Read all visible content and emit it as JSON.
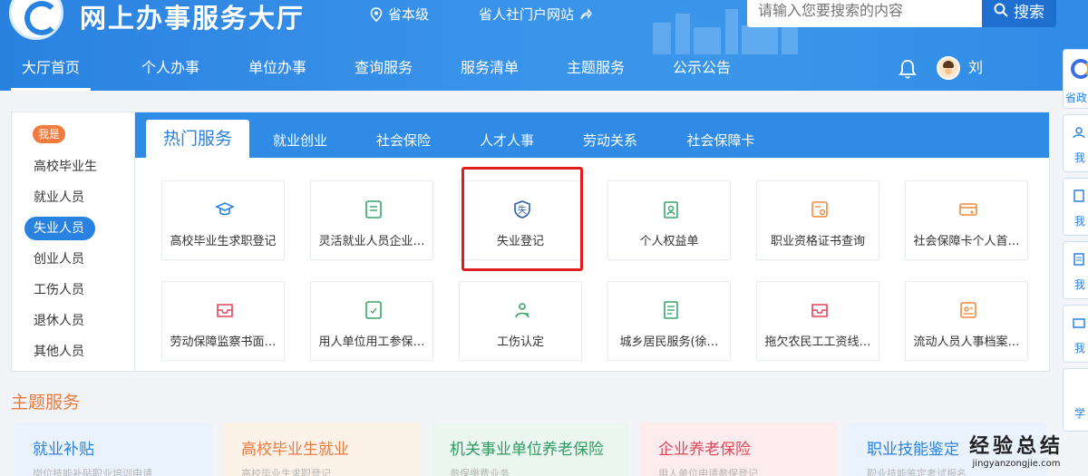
{
  "header": {
    "title": "网上办事服务大厅",
    "region": "省本级",
    "portal_link": "省人社门户网站",
    "search_placeholder": "请输入您要搜索的内容",
    "search_button": "搜索",
    "username": "刘"
  },
  "nav": [
    {
      "label": "大厅首页",
      "active": true
    },
    {
      "label": "个人办事"
    },
    {
      "label": "单位办事"
    },
    {
      "label": "查询服务"
    },
    {
      "label": "服务清单"
    },
    {
      "label": "主题服务"
    },
    {
      "label": "公示公告"
    }
  ],
  "identity": {
    "badge": "我是",
    "items": [
      "高校毕业生",
      "就业人员",
      "失业人员",
      "创业人员",
      "工伤人员",
      "退休人员",
      "其他人员"
    ],
    "active_index": 2
  },
  "tabs": [
    "热门服务",
    "就业创业",
    "社会保险",
    "人才人事",
    "劳动关系",
    "社会保障卡"
  ],
  "services": [
    {
      "label": "高校毕业生求职登记",
      "icon": "graduation-cap-icon"
    },
    {
      "label": "灵活就业人员企业…",
      "icon": "document-card-icon"
    },
    {
      "label": "失业登记",
      "icon": "unemployment-shield-icon",
      "icon_char": "失"
    },
    {
      "label": "个人权益单",
      "icon": "clipboard-person-icon"
    },
    {
      "label": "职业资格证书查询",
      "icon": "certificate-search-icon"
    },
    {
      "label": "社会保障卡个人首…",
      "icon": "social-security-card-icon"
    },
    {
      "label": "劳动保障监察书面…",
      "icon": "inbox-icon"
    },
    {
      "label": "用人单位用工参保…",
      "icon": "insurance-doc-icon"
    },
    {
      "label": "工伤认定",
      "icon": "injury-icon"
    },
    {
      "label": "城乡居民服务(徐…",
      "icon": "resident-doc-icon"
    },
    {
      "label": "拖欠农民工工资线…",
      "icon": "wage-inbox-icon"
    },
    {
      "label": "流动人员人事档案…",
      "icon": "personnel-file-icon"
    }
  ],
  "theme_section": {
    "title": "主题服务",
    "cards": [
      {
        "title": "就业补贴",
        "subtitle": "岗位技能补贴职业培训申请"
      },
      {
        "title": "高校毕业生就业",
        "subtitle": "高校毕业生求职登记"
      },
      {
        "title": "机关事业单位养老保险",
        "subtitle": "参保缴费业务"
      },
      {
        "title": "企业养老保险",
        "subtitle": "用人单位申请参保登记"
      },
      {
        "title": "职业技能鉴定",
        "subtitle": "职业技能鉴定考试报名"
      }
    ]
  },
  "float_bar": [
    "省政",
    "我",
    "我",
    "我",
    "我",
    "学"
  ],
  "watermark": {
    "main": "经验总结",
    "url": "jingyanzongjie.com"
  },
  "colors": {
    "primary": "#2a82e0",
    "accent_orange": "#f07b3f",
    "highlight_red": "#e11c1c",
    "theme_title": "#e8793f"
  }
}
